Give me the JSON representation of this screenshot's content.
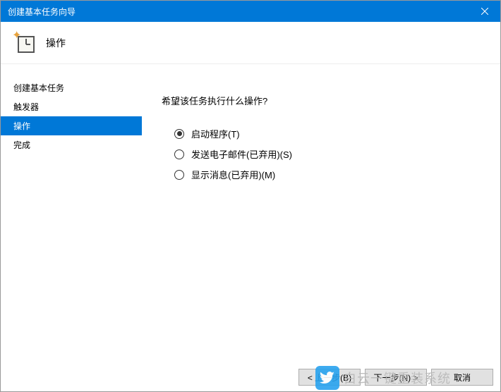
{
  "titlebar": {
    "title": "创建基本任务向导"
  },
  "header": {
    "title": "操作"
  },
  "sidebar": {
    "items": [
      {
        "label": "创建基本任务",
        "active": false
      },
      {
        "label": "触发器",
        "active": false
      },
      {
        "label": "操作",
        "active": true
      },
      {
        "label": "完成",
        "active": false
      }
    ]
  },
  "main": {
    "prompt": "希望该任务执行什么操作?",
    "options": [
      {
        "label": "启动程序(T)",
        "checked": true
      },
      {
        "label": "发送电子邮件(已弃用)(S)",
        "checked": false
      },
      {
        "label": "显示消息(已弃用)(M)",
        "checked": false
      }
    ]
  },
  "footer": {
    "back": "< 上一步(B)",
    "next": "下一步(N) >",
    "cancel": "取消"
  },
  "watermark": {
    "text": "白云一键重装系统"
  }
}
